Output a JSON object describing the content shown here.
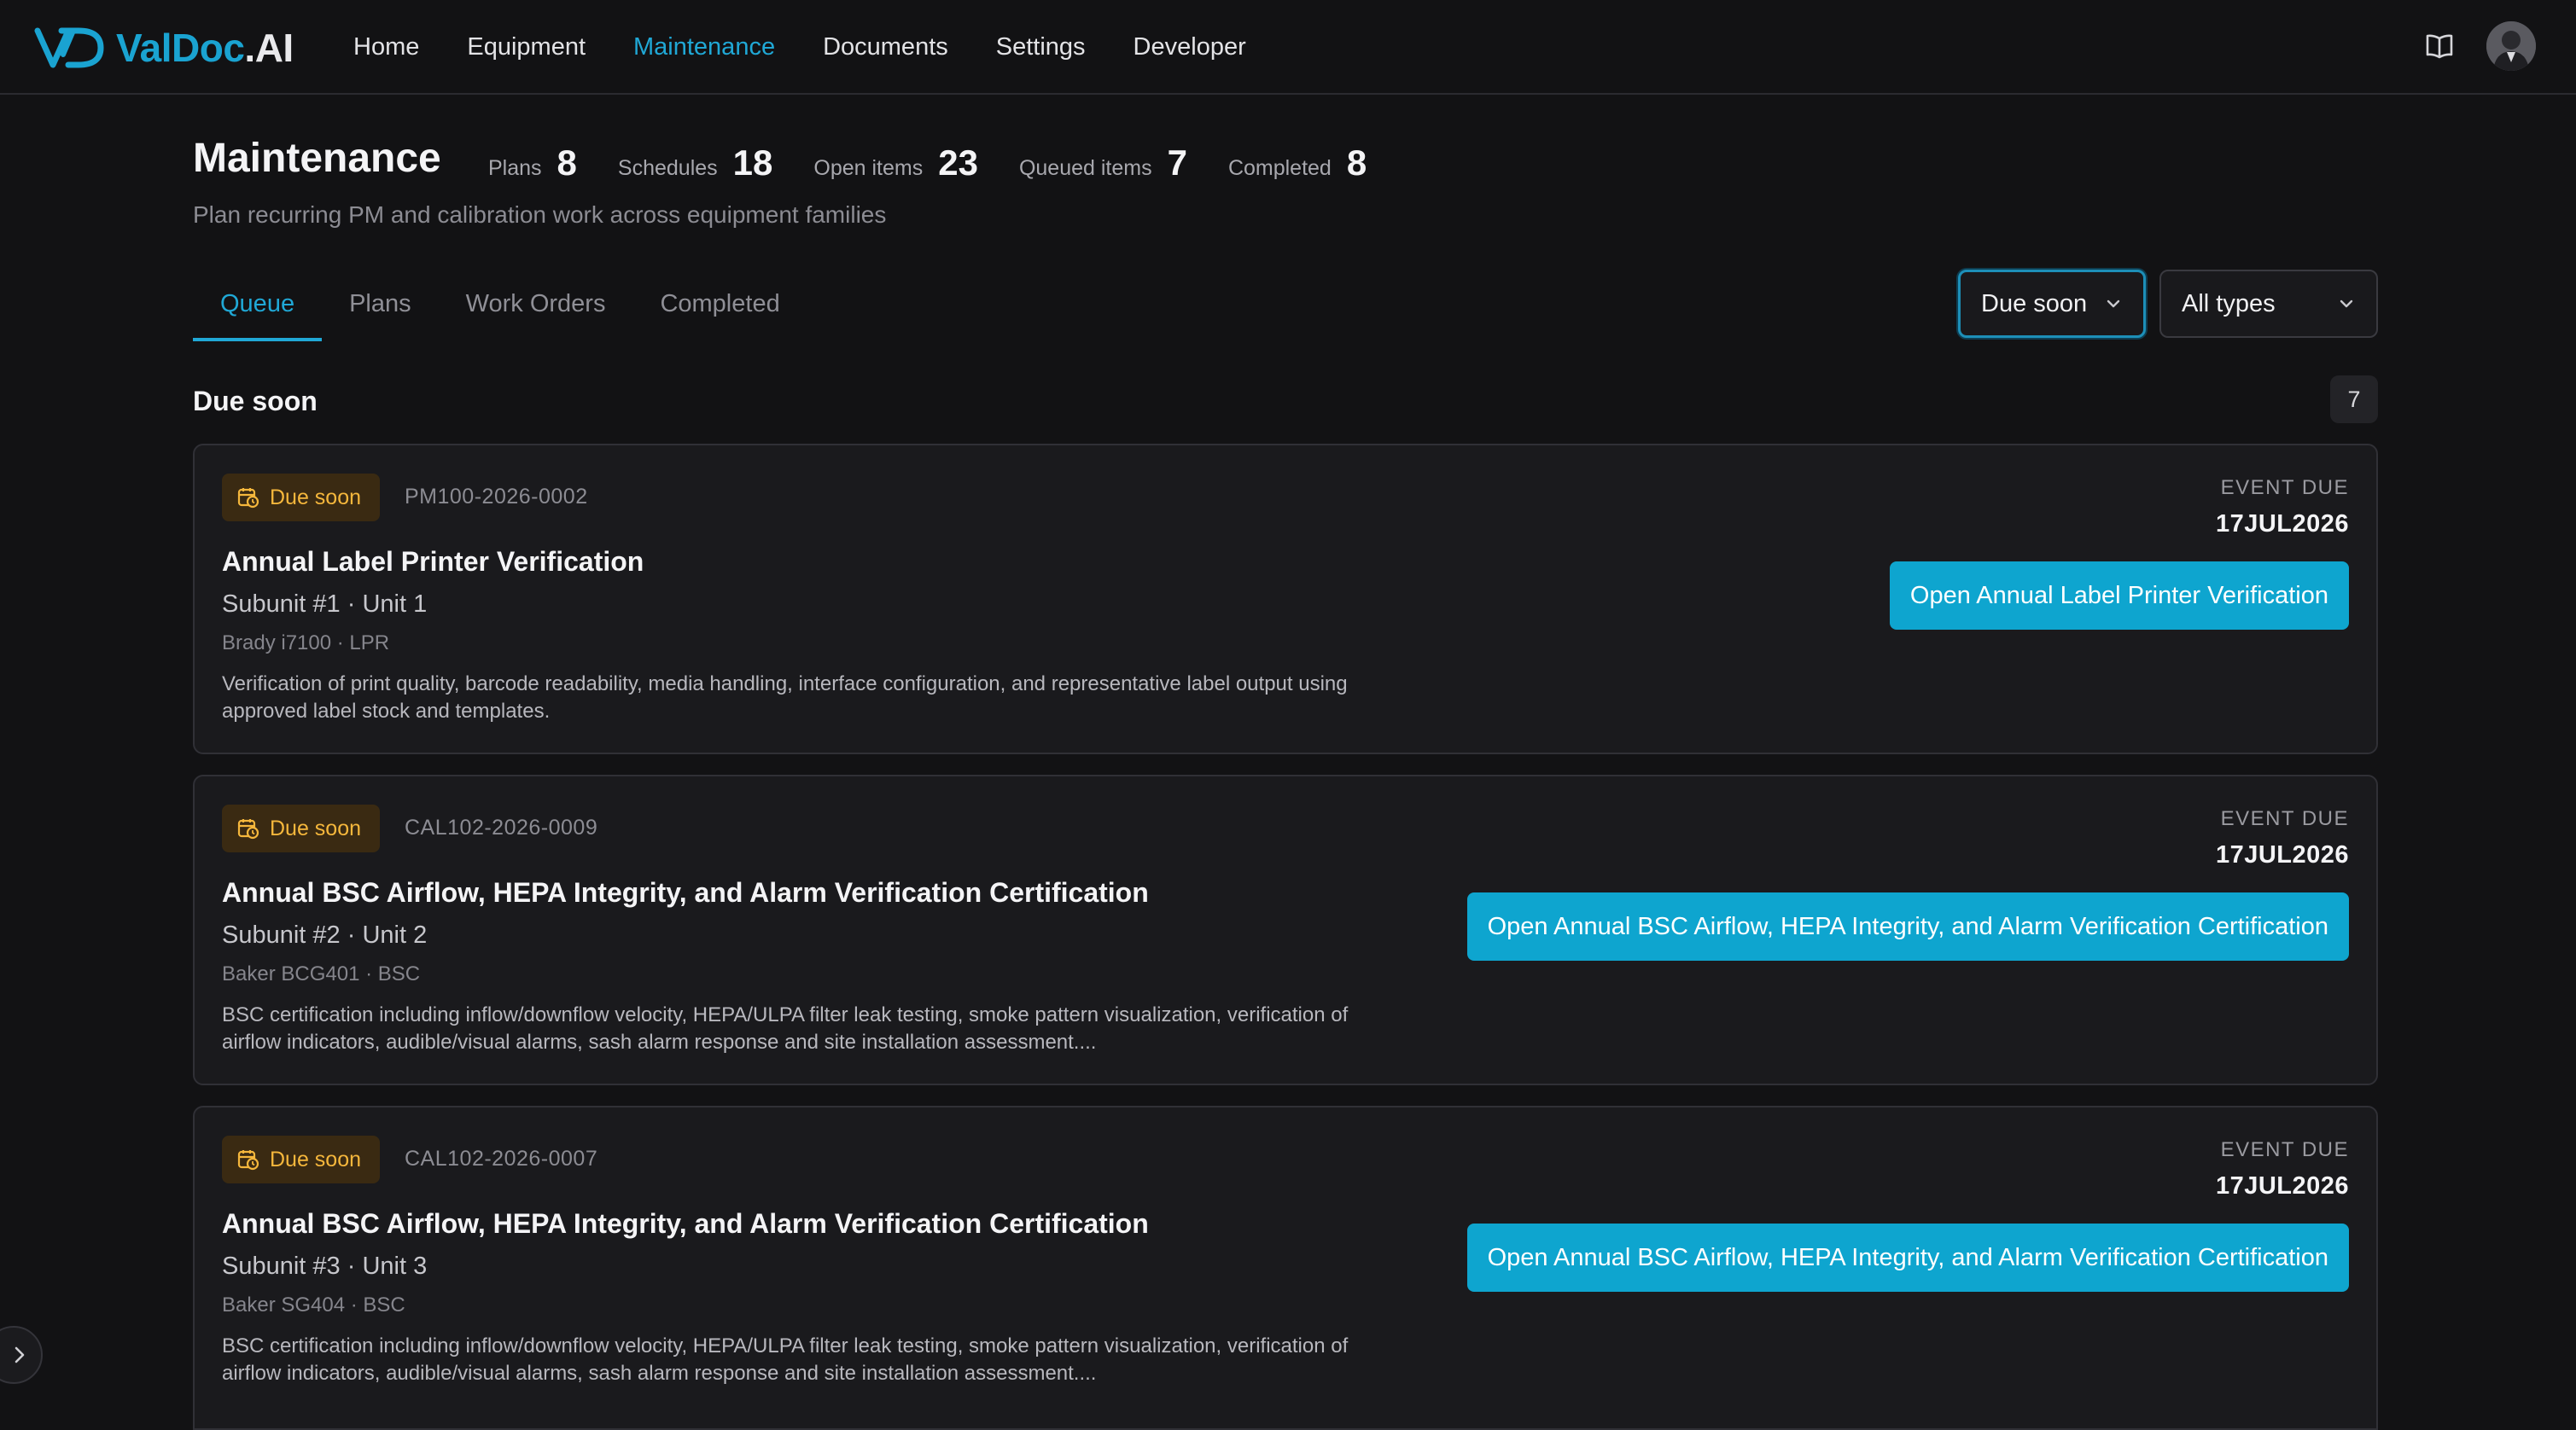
{
  "brand": {
    "name_main": "ValDoc",
    "name_suffix": ".AI",
    "color": "#1aa3d1"
  },
  "nav": {
    "items": [
      {
        "label": "Home",
        "active": false
      },
      {
        "label": "Equipment",
        "active": false
      },
      {
        "label": "Maintenance",
        "active": true
      },
      {
        "label": "Documents",
        "active": false
      },
      {
        "label": "Settings",
        "active": false
      },
      {
        "label": "Developer",
        "active": false
      }
    ],
    "icons": {
      "docs": "book-icon",
      "avatar": "user-avatar"
    }
  },
  "header": {
    "title": "Maintenance",
    "subtitle": "Plan recurring PM and calibration work across equipment families",
    "stats": [
      {
        "label": "Plans",
        "value": "8"
      },
      {
        "label": "Schedules",
        "value": "18"
      },
      {
        "label": "Open items",
        "value": "23"
      },
      {
        "label": "Queued items",
        "value": "7"
      },
      {
        "label": "Completed",
        "value": "8"
      }
    ]
  },
  "tabs": [
    {
      "label": "Queue",
      "active": true
    },
    {
      "label": "Plans",
      "active": false
    },
    {
      "label": "Work Orders",
      "active": false
    },
    {
      "label": "Completed",
      "active": false
    }
  ],
  "filters": {
    "due": {
      "selected": "Due soon"
    },
    "type": {
      "selected": "All types"
    }
  },
  "section": {
    "title": "Due soon",
    "count": "7"
  },
  "cards": [
    {
      "badge": "Due soon",
      "ref": "PM100-2026-0002",
      "title": "Annual Label Printer Verification",
      "subunit": "Subunit #1 · Unit 1",
      "model": "Brady i7100 · LPR",
      "description": "Verification of print quality, barcode readability, media handling, interface configuration, and representative label output using approved label stock and templates.",
      "due_label": "EVENT DUE",
      "due_date": "17JUL2026",
      "action": "Open Annual Label Printer Verification"
    },
    {
      "badge": "Due soon",
      "ref": "CAL102-2026-0009",
      "title": "Annual BSC Airflow, HEPA Integrity, and Alarm Verification Certification",
      "subunit": "Subunit #2 · Unit 2",
      "model": "Baker BCG401 · BSC",
      "description": "BSC certification including inflow/downflow velocity, HEPA/ULPA filter leak testing, smoke pattern visualization, verification of airflow indicators, audible/visual alarms, sash alarm response and site installation assessment....",
      "due_label": "EVENT DUE",
      "due_date": "17JUL2026",
      "action": "Open Annual BSC Airflow, HEPA Integrity, and Alarm Verification Certification"
    },
    {
      "badge": "Due soon",
      "ref": "CAL102-2026-0007",
      "title": "Annual BSC Airflow, HEPA Integrity, and Alarm Verification Certification",
      "subunit": "Subunit #3 · Unit 3",
      "model": "Baker SG404 · BSC",
      "description": "BSC certification including inflow/downflow velocity, HEPA/ULPA filter leak testing, smoke pattern visualization, verification of airflow indicators, audible/visual alarms, sash alarm response and site installation assessment....",
      "due_label": "EVENT DUE",
      "due_date": "17JUL2026",
      "action": "Open Annual BSC Airflow, HEPA Integrity, and Alarm Verification Certification"
    }
  ],
  "colors": {
    "accent": "#20a8d6",
    "button": "#0ea5cf",
    "badge_text": "#f5b73c",
    "badge_bg": "#3a2a12",
    "background": "#121214",
    "card": "#1a1a1d"
  }
}
